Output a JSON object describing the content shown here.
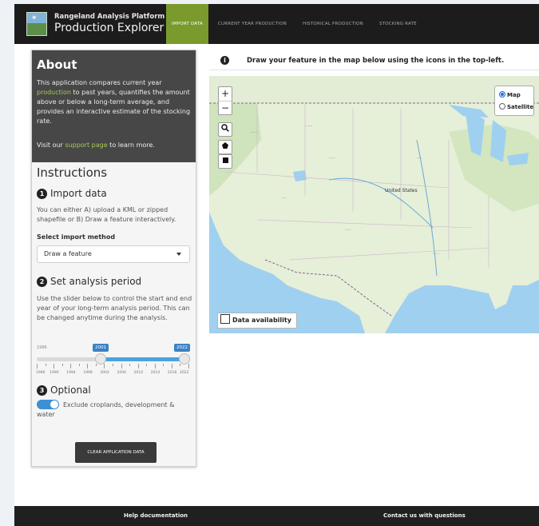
{
  "app": {
    "org": "Rangeland Analysis Platform",
    "title": "Production Explorer"
  },
  "tabs": [
    {
      "label": "Import data",
      "active": true
    },
    {
      "label": "Current year production",
      "active": false
    },
    {
      "label": "Historical production",
      "active": false
    },
    {
      "label": "Stocking rate",
      "active": false
    }
  ],
  "about": {
    "heading": "About",
    "text_1": "This application compares current year ",
    "link_production": "production",
    "text_2": " to past years, quantifies the amount above or below a long-term average, and provides an interactive estimate of the stocking rate.",
    "visit_1": "Visit our ",
    "link_support": "support page",
    "visit_2": " to learn more."
  },
  "instructions": {
    "heading": "Instructions",
    "step1": {
      "num": "1",
      "title": "Import data",
      "text": "You can either A) upload a KML or zipped shapefile or B) Draw a feature interactively.",
      "select_label": "Select import method",
      "select_value": "Draw a feature"
    },
    "step2": {
      "num": "2",
      "title": "Set analysis period",
      "text": "Use the slider below to control the start and end year of your long-term analysis period. This can be changed anytime during the analysis."
    },
    "slider": {
      "min": "1986",
      "start": "2001",
      "end": "2022",
      "min_value": 1986,
      "max_value": 2022,
      "start_value": 2001,
      "end_value": 2022,
      "tick_labels": [
        "1986",
        "1990",
        "1994",
        "1998",
        "2002",
        "2006",
        "2010",
        "2014",
        "2018",
        "2022"
      ]
    },
    "step3": {
      "num": "3",
      "title": "Optional",
      "toggle_label": "Exclude croplands, development & water",
      "toggle_on": true
    },
    "clear_button": "Clear application data"
  },
  "map": {
    "info_icon": "info-icon",
    "instruction": "Draw your feature in the map below using the icons in the top-left.",
    "zoom_in": "+",
    "zoom_out": "−",
    "search_icon": "search-icon",
    "polygon_icon": "polygon-icon",
    "rectangle_icon": "rectangle-icon",
    "layers": [
      {
        "label": "Map",
        "selected": true
      },
      {
        "label": "Satellite",
        "selected": false
      }
    ],
    "country_label": "United States",
    "data_availability": "Data availability",
    "colors": {
      "water": "#9fd0f0",
      "land": "#e6efd8",
      "forest": "#cfe3bd"
    }
  },
  "footer": {
    "help": "Help documentation",
    "contact": "Contact us with questions"
  },
  "colors": {
    "nav_bg": "#1c1c1c",
    "accent_green": "#7a9a2e",
    "about_bg": "#474747",
    "slider_blue": "#3b82c4"
  }
}
